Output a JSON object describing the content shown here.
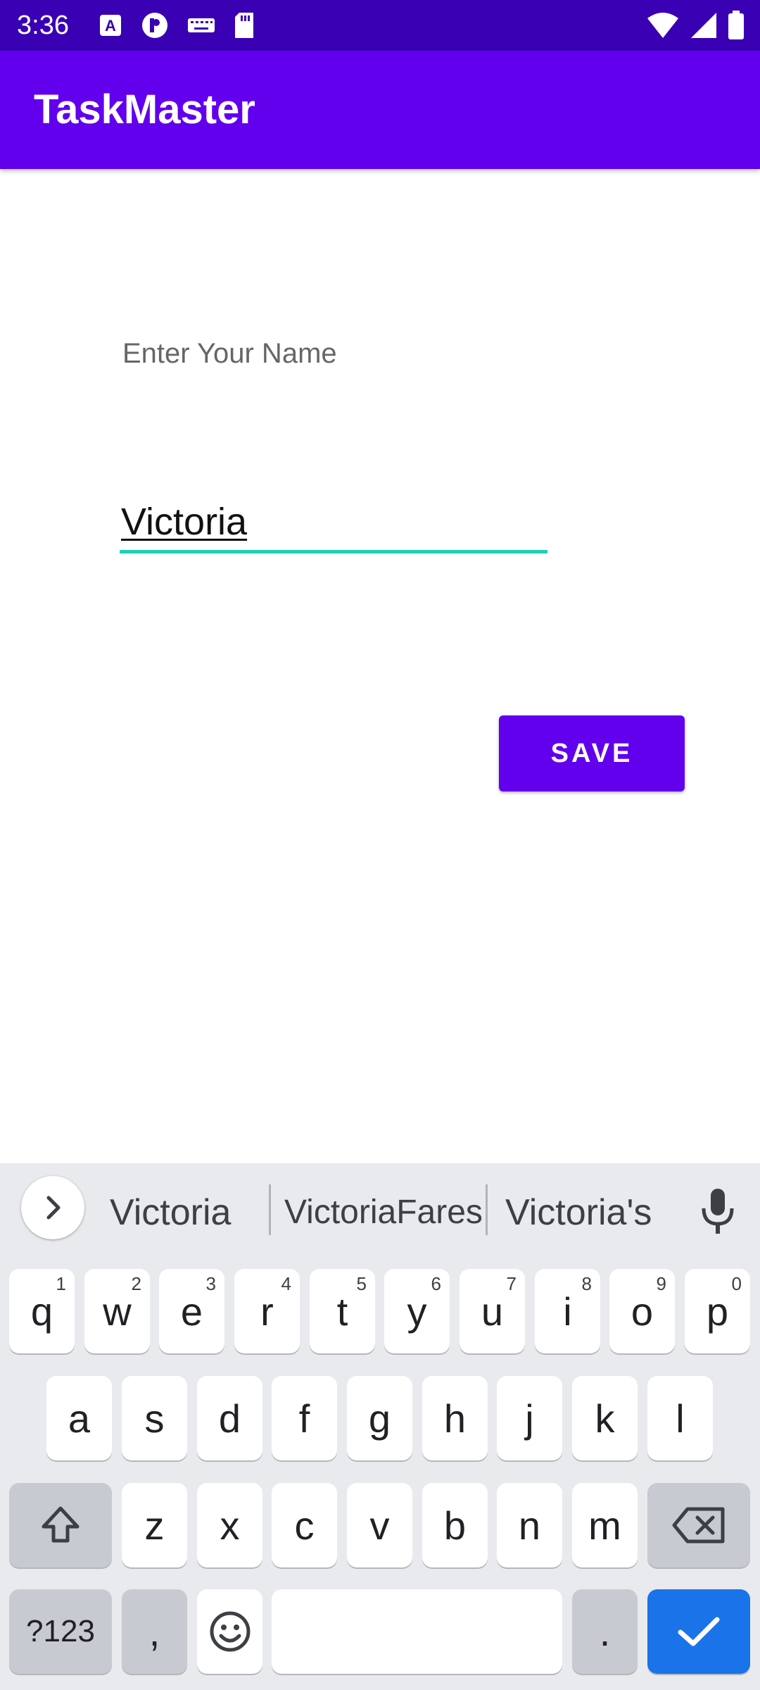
{
  "status_bar": {
    "time": "3:36"
  },
  "app_bar": {
    "title": "TaskMaster"
  },
  "form": {
    "name_label": "Enter Your Name",
    "name_value": "Victoria",
    "save_label": "SAVE"
  },
  "keyboard": {
    "suggestions": [
      "Victoria",
      "VictoriaFares",
      "Victoria's"
    ],
    "row1": [
      {
        "k": "q",
        "h": "1"
      },
      {
        "k": "w",
        "h": "2"
      },
      {
        "k": "e",
        "h": "3"
      },
      {
        "k": "r",
        "h": "4"
      },
      {
        "k": "t",
        "h": "5"
      },
      {
        "k": "y",
        "h": "6"
      },
      {
        "k": "u",
        "h": "7"
      },
      {
        "k": "i",
        "h": "8"
      },
      {
        "k": "o",
        "h": "9"
      },
      {
        "k": "p",
        "h": "0"
      }
    ],
    "row2": [
      "a",
      "s",
      "d",
      "f",
      "g",
      "h",
      "j",
      "k",
      "l"
    ],
    "row3": [
      "z",
      "x",
      "c",
      "v",
      "b",
      "n",
      "m"
    ],
    "symbols_label": "?123",
    "comma_label": ",",
    "period_label": "."
  },
  "colors": {
    "accent": "#6200ee",
    "status_bar": "#3a00b4",
    "input_underline": "#1ecfb8",
    "enter_key": "#1a73e8"
  }
}
